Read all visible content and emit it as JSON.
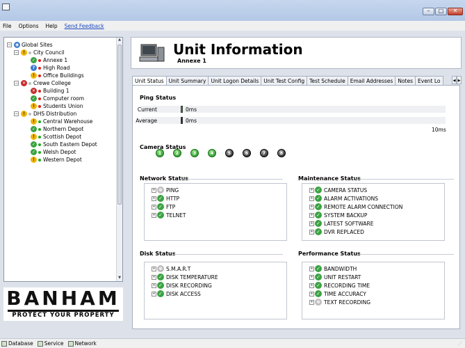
{
  "menu": {
    "file": "File",
    "options": "Options",
    "help": "Help",
    "feedback": "Send Feedback"
  },
  "tree": [
    {
      "label": "Global Sites",
      "icon": "globe",
      "dot": "",
      "expander": "minus",
      "x": 0,
      "y": 0
    },
    {
      "label": "City Council",
      "icon": "warn",
      "dot": "#bbb",
      "expander": "minus",
      "x": 10,
      "y": 1
    },
    {
      "label": "Annexe 1",
      "icon": "ok",
      "dot": "#d22",
      "expander": "",
      "x": 24,
      "y": 2
    },
    {
      "label": "High Road",
      "icon": "info",
      "dot": "#d22",
      "expander": "",
      "x": 24,
      "y": 3
    },
    {
      "label": "Office Buildings",
      "icon": "warn",
      "dot": "#d22",
      "expander": "",
      "x": 24,
      "y": 4
    },
    {
      "label": "Crewe College",
      "icon": "err",
      "dot": "#bbb",
      "expander": "minus",
      "x": 10,
      "y": 5
    },
    {
      "label": "Building 1",
      "icon": "err",
      "dot": "#d22",
      "expander": "",
      "x": 24,
      "y": 6
    },
    {
      "label": "Computer room",
      "icon": "ok",
      "dot": "#d22",
      "expander": "",
      "x": 24,
      "y": 7
    },
    {
      "label": "Students Union",
      "icon": "warn",
      "dot": "#d22",
      "expander": "",
      "x": 24,
      "y": 8
    },
    {
      "label": "DHS Distribution",
      "icon": "warn",
      "dot": "#bbb",
      "expander": "minus",
      "x": 10,
      "y": 9
    },
    {
      "label": "Central Warehouse",
      "icon": "warn",
      "dot": "#2a2",
      "expander": "",
      "x": 24,
      "y": 10
    },
    {
      "label": "Northern Depot",
      "icon": "ok",
      "dot": "#2a2",
      "expander": "",
      "x": 24,
      "y": 11
    },
    {
      "label": "Scottish Depot",
      "icon": "warn",
      "dot": "#2a2",
      "expander": "",
      "x": 24,
      "y": 12
    },
    {
      "label": "South Eastern Depot",
      "icon": "ok",
      "dot": "#2a2",
      "expander": "",
      "x": 24,
      "y": 13
    },
    {
      "label": "Welsh Depot",
      "icon": "ok",
      "dot": "#2a2",
      "expander": "",
      "x": 24,
      "y": 14
    },
    {
      "label": "Western Depot",
      "icon": "warn",
      "dot": "#2a2",
      "expander": "",
      "x": 24,
      "y": 15
    }
  ],
  "logo": {
    "name": "BANHAM",
    "tagline": "PROTECT YOUR PROPERTY"
  },
  "header": {
    "title": "Unit Information",
    "subtitle": "Annexe 1"
  },
  "tabs": [
    "Unit Status",
    "Unit Summary",
    "Unit Logon Details",
    "Unit Test Config",
    "Test Schedule",
    "Email Addresses",
    "Notes",
    "Event Lo"
  ],
  "ping": {
    "title": "Ping Status",
    "current_label": "Current",
    "current_value": "0ms",
    "average_label": "Average",
    "average_value": "0ms",
    "max": "10ms"
  },
  "camera": {
    "title": "Camera Status",
    "cams": [
      {
        "n": "1",
        "on": true
      },
      {
        "n": "2",
        "on": true
      },
      {
        "n": "3",
        "on": true
      },
      {
        "n": "4",
        "on": true
      },
      {
        "n": "5",
        "on": false
      },
      {
        "n": "6",
        "on": false
      },
      {
        "n": "7",
        "on": false
      },
      {
        "n": "8",
        "on": false
      }
    ]
  },
  "network": {
    "title": "Network Status",
    "items": [
      {
        "label": "PING",
        "ok": false
      },
      {
        "label": "HTTP",
        "ok": true
      },
      {
        "label": "FTP",
        "ok": true
      },
      {
        "label": "TELNET",
        "ok": true
      }
    ]
  },
  "maintenance": {
    "title": "Maintenance Status",
    "items": [
      {
        "label": "CAMERA STATUS",
        "ok": true
      },
      {
        "label": "ALARM ACTIVATIONS",
        "ok": true
      },
      {
        "label": "REMOTE ALARM CONNECTION",
        "ok": true
      },
      {
        "label": "SYSTEM BACKUP",
        "ok": true
      },
      {
        "label": "LATEST SOFTWARE",
        "ok": true
      },
      {
        "label": "DVR REPLACED",
        "ok": true
      }
    ]
  },
  "disk": {
    "title": "Disk Status",
    "items": [
      {
        "label": "S.M.A.R.T",
        "ok": false
      },
      {
        "label": "DISK TEMPERATURE",
        "ok": true
      },
      {
        "label": "DISK RECORDING",
        "ok": true
      },
      {
        "label": "DISK ACCESS",
        "ok": true
      }
    ]
  },
  "performance": {
    "title": "Performance Status",
    "items": [
      {
        "label": "BANDWIDTH",
        "ok": true
      },
      {
        "label": "UNIT RESTART",
        "ok": true
      },
      {
        "label": "RECORDING TIME",
        "ok": true
      },
      {
        "label": "TIME ACCURACY",
        "ok": true
      },
      {
        "label": "TEXT RECORDING",
        "ok": false
      }
    ]
  },
  "statusbar": {
    "database": "Database",
    "service": "Service",
    "network": "Network"
  }
}
